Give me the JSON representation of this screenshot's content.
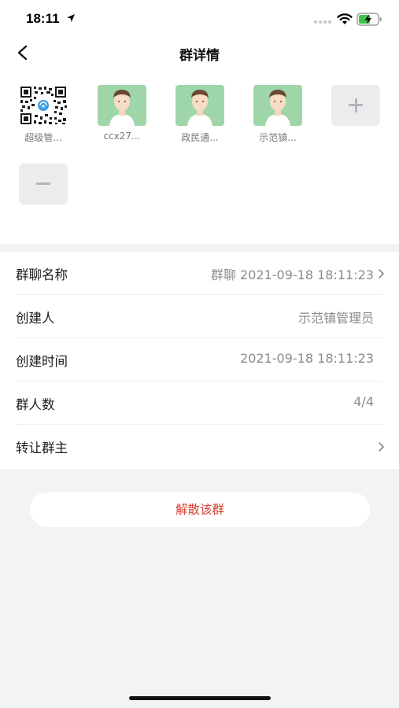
{
  "status_bar": {
    "time": "18:11"
  },
  "nav": {
    "title": "群详情"
  },
  "members": [
    {
      "name": "超级管...",
      "avatar": "qr-code"
    },
    {
      "name": "ccx27...",
      "avatar": "person"
    },
    {
      "name": "政民通...",
      "avatar": "person"
    },
    {
      "name": "示范镇...",
      "avatar": "person"
    }
  ],
  "actions": {
    "add_icon": "plus-icon",
    "remove_icon": "minus-icon"
  },
  "info": {
    "group_name": {
      "label": "群聊名称",
      "value": "群聊 2021-09-18 18:11:23"
    },
    "creator": {
      "label": "创建人",
      "value": "示范镇管理员"
    },
    "created_time": {
      "label": "创建时间",
      "value": "2021-09-18 18:11:23"
    },
    "member_count": {
      "label": "群人数",
      "value": "4/4"
    },
    "transfer_owner": {
      "label": "转让群主"
    }
  },
  "dissolve_label": "解散该群",
  "colors": {
    "accent_red": "#d9412e",
    "avatar_bg": "#9fd6a9",
    "page_bg": "#f2f3f5"
  }
}
